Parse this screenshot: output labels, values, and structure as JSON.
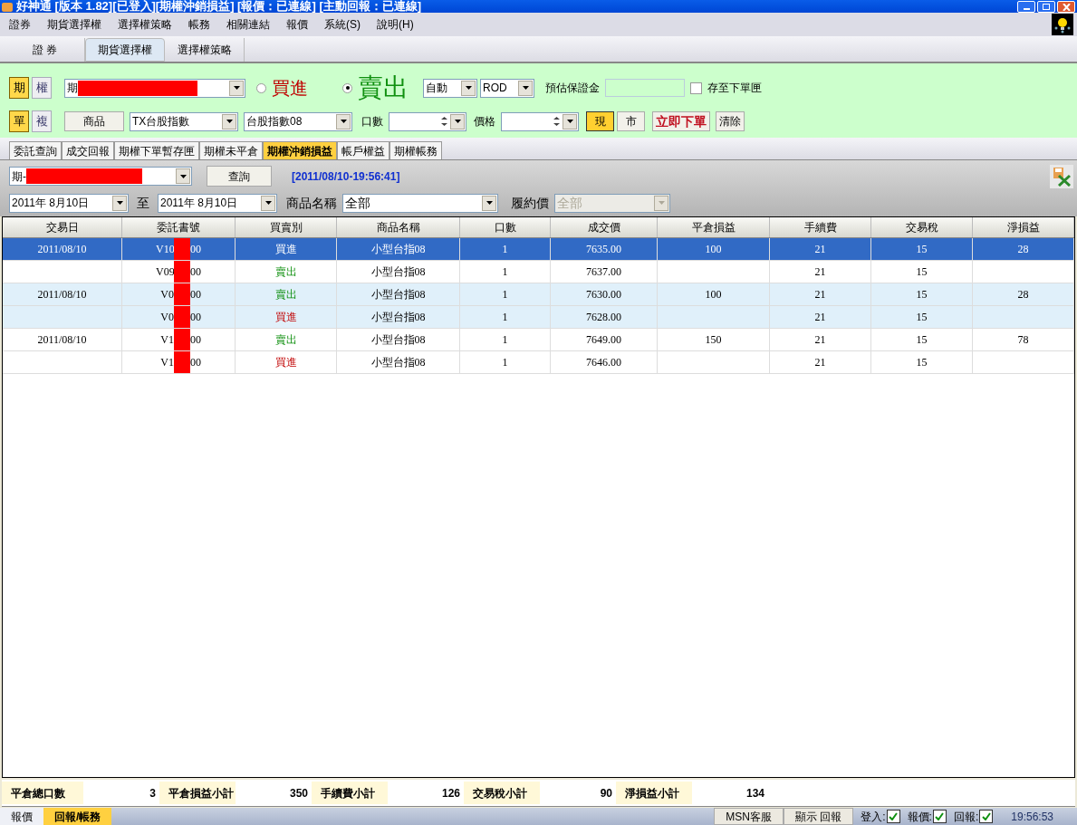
{
  "window": {
    "title": "好神通 [版本 1.82][已登入][期權沖銷損益] [報價：已連線] [主動回報：已連線]"
  },
  "menu": [
    "證券",
    "期貨選擇權",
    "選擇權策略",
    "帳務",
    "相關連結",
    "報價",
    "系統(S)",
    "說明(H)"
  ],
  "main_tabs": [
    {
      "label": "證 券",
      "selected": false
    },
    {
      "label": "期貨選擇權",
      "selected": true
    },
    {
      "label": "選擇權策略",
      "selected": false
    }
  ],
  "order_panel": {
    "type_toggle": [
      {
        "label": "期",
        "selected": true
      },
      {
        "label": "權",
        "selected": false
      }
    ],
    "account": "期",
    "sides": [
      {
        "label": "買進",
        "kind": "buy",
        "selected": false
      },
      {
        "label": "賣出",
        "kind": "sell",
        "selected": true
      }
    ],
    "condition": "自動",
    "time_in_force": "ROD",
    "margin_label": "預估保證金",
    "save_to_box": {
      "label": "存至下單匣",
      "checked": false
    },
    "mode_toggle": [
      {
        "label": "單",
        "selected": true
      },
      {
        "label": "複",
        "selected": false
      }
    ],
    "product_button": "商品",
    "product": "TX台股指數",
    "contract": "台股指數08",
    "qty_label": "口數",
    "price_label": "價格",
    "price_type": [
      {
        "label": "現",
        "selected": true
      },
      {
        "label": "市",
        "selected": false
      }
    ],
    "submit": "立即下單",
    "clear": "清除"
  },
  "sub_tabs": [
    {
      "label": "委託查詢",
      "selected": false
    },
    {
      "label": "成交回報",
      "selected": false
    },
    {
      "label": "期權下單暫存匣",
      "selected": false
    },
    {
      "label": "期權未平倉",
      "selected": false
    },
    {
      "label": "期權沖銷損益",
      "selected": true
    },
    {
      "label": "帳戶權益",
      "selected": false
    },
    {
      "label": "期權帳務",
      "selected": false
    }
  ],
  "query": {
    "account": "期-",
    "query_button": "查詢",
    "timestamp": "[2011/08/10-19:56:41]",
    "date_from": "2011年  8月10日",
    "to_label": "至",
    "date_to": "2011年  8月10日",
    "product_label": "商品名稱",
    "product": "全部",
    "strike_label": "履約價",
    "strike": "全部"
  },
  "table": {
    "columns": [
      "交易日",
      "委託書號",
      "買賣別",
      "商品名稱",
      "口數",
      "成交價",
      "平倉損益",
      "手續費",
      "交易稅",
      "淨損益"
    ],
    "rows": [
      {
        "selected": true,
        "shaded": false,
        "date": "2011/08/10",
        "order_prefix": "V10",
        "order_suffix": "00",
        "side": "買進",
        "kind": "buy",
        "product": "小型台指08",
        "qty": "1",
        "price": "7635.00",
        "pnl": "100",
        "fee": "21",
        "tax": "15",
        "net": "28"
      },
      {
        "selected": false,
        "shaded": false,
        "date": "",
        "order_prefix": "V09",
        "order_suffix": "00",
        "side": "賣出",
        "kind": "sell",
        "product": "小型台指08",
        "qty": "1",
        "price": "7637.00",
        "pnl": "",
        "fee": "21",
        "tax": "15",
        "net": ""
      },
      {
        "selected": false,
        "shaded": true,
        "date": "2011/08/10",
        "order_prefix": "V0",
        "order_suffix": "00",
        "side": "賣出",
        "kind": "sell",
        "product": "小型台指08",
        "qty": "1",
        "price": "7630.00",
        "pnl": "100",
        "fee": "21",
        "tax": "15",
        "net": "28"
      },
      {
        "selected": false,
        "shaded": true,
        "date": "",
        "order_prefix": "V0",
        "order_suffix": "00",
        "side": "買進",
        "kind": "buy",
        "product": "小型台指08",
        "qty": "1",
        "price": "7628.00",
        "pnl": "",
        "fee": "21",
        "tax": "15",
        "net": ""
      },
      {
        "selected": false,
        "shaded": false,
        "date": "2011/08/10",
        "order_prefix": "V1",
        "order_suffix": "00",
        "side": "賣出",
        "kind": "sell",
        "product": "小型台指08",
        "qty": "1",
        "price": "7649.00",
        "pnl": "150",
        "fee": "21",
        "tax": "15",
        "net": "78"
      },
      {
        "selected": false,
        "shaded": false,
        "date": "",
        "order_prefix": "V1",
        "order_suffix": "00",
        "side": "買進",
        "kind": "buy",
        "product": "小型台指08",
        "qty": "1",
        "price": "7646.00",
        "pnl": "",
        "fee": "21",
        "tax": "15",
        "net": ""
      }
    ]
  },
  "summary": [
    {
      "label": "平倉總口數",
      "value": "3"
    },
    {
      "label": "平倉損益小計",
      "value": "350"
    },
    {
      "label": "手續費小計",
      "value": "126"
    },
    {
      "label": "交易稅小計",
      "value": "90"
    },
    {
      "label": "淨損益小計",
      "value": "134"
    }
  ],
  "bottom_tabs": [
    {
      "label": "報價",
      "selected": false
    },
    {
      "label": "回報/帳務",
      "selected": true
    }
  ],
  "status_bar": {
    "buttons": [
      "MSN客服",
      "顯示 回報"
    ],
    "indicators": [
      {
        "label": "登入:",
        "checked": true
      },
      {
        "label": "報價:",
        "checked": true
      },
      {
        "label": "回報:",
        "checked": true
      }
    ],
    "time": "19:56:53"
  }
}
